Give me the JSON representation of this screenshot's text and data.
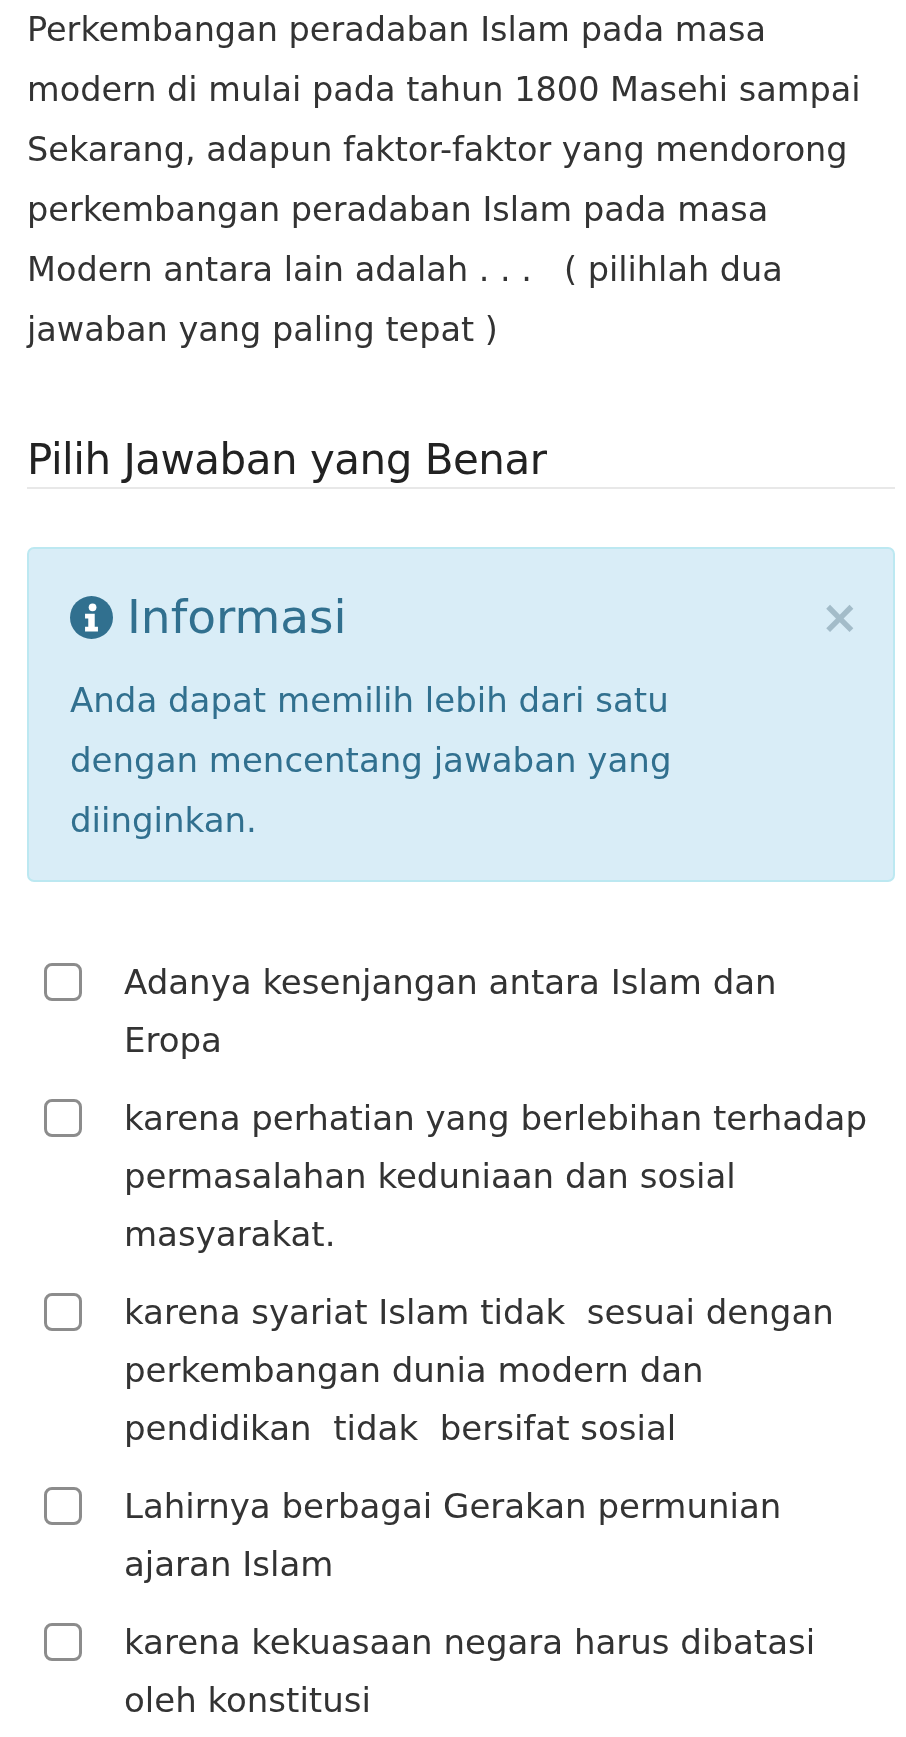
{
  "question": {
    "text": "Perkembangan peradaban Islam pada masa modern di mulai pada tahun 1800 Masehi sampai Sekarang, adapun faktor-faktor yang mendorong perkembangan peradaban Islam pada masa Modern antara lain adalah . . .   ( pilihlah dua jawaban yang paling tepat )"
  },
  "answer_section": {
    "title": "Pilih Jawaban yang Benar"
  },
  "alert": {
    "title": "Informasi",
    "close": "×",
    "message": "Anda dapat memilih lebih dari satu dengan mencentang jawaban yang diinginkan."
  },
  "options": [
    {
      "label": "Adanya kesenjangan antara Islam dan Eropa",
      "checked": false
    },
    {
      "label": "karena perhatian yang berlebihan terhadap permasalahan keduniaan dan sosial masyarakat.",
      "checked": false
    },
    {
      "label": "karena syariat Islam tidak  sesuai dengan perkembangan dunia modern dan pendidikan  tidak  bersifat sosial",
      "checked": false
    },
    {
      "label": "Lahirnya berbagai Gerakan permunian ajaran Islam",
      "checked": false
    },
    {
      "label": "karena kekuasaan negara harus dibatasi oleh konstitusi",
      "checked": false
    }
  ]
}
